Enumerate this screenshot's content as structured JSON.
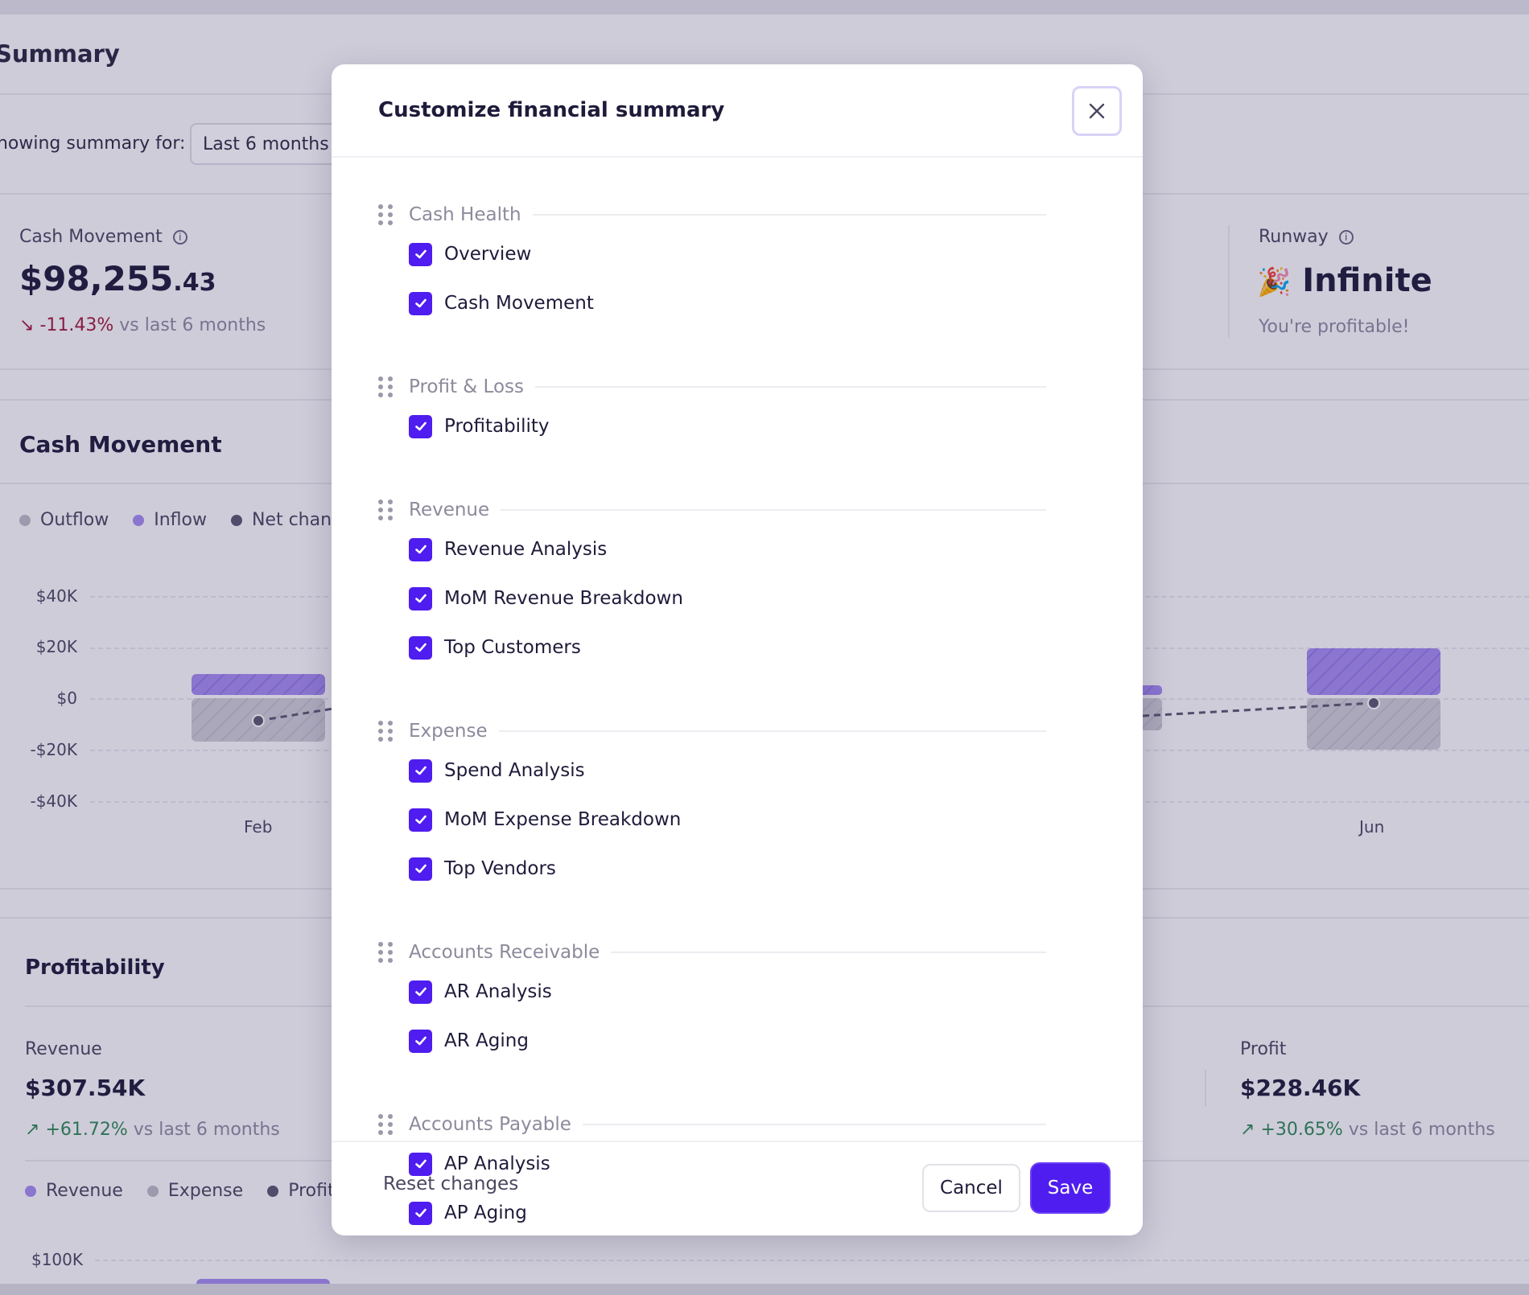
{
  "background": {
    "page_title": "Summary",
    "showing_label": "Showing summary for:",
    "range_value": "Last 6 months",
    "cash_movement": {
      "label": "Cash Movement",
      "value_main": "$98,255",
      "value_cents": ".43",
      "change": "-11.43%",
      "change_suffix": "vs last 6 months"
    },
    "runway": {
      "label": "Runway",
      "value": "Infinite",
      "sub": "You're profitable!"
    },
    "cash_section": {
      "title": "Cash Movement",
      "legend": [
        "Outflow",
        "Inflow",
        "Net change"
      ],
      "y_ticks": [
        "$40K",
        "$20K",
        "$0",
        "-$20K",
        "-$40K"
      ],
      "x_ticks": [
        "Feb",
        "Jun"
      ]
    },
    "profit_section": {
      "title": "Profitability",
      "revenue_label": "Revenue",
      "revenue_value": "$307.54K",
      "revenue_change": "+61.72%",
      "profit_label": "Profit",
      "profit_value": "$228.46K",
      "profit_change": "+30.65%",
      "change_suffix": "vs last 6 months",
      "legend": [
        "Revenue",
        "Expense",
        "Profit"
      ],
      "y_tick_top": "$100K"
    },
    "colors": {
      "inflow": "#8b6fe0",
      "outflow": "#b4b2be",
      "net": "#5b5870",
      "negative": "#a21c3d",
      "positive": "#2f8a55"
    }
  },
  "modal": {
    "title": "Customize financial summary",
    "close_icon": "close-icon",
    "groups": [
      {
        "label": "Cash Health",
        "items": [
          "Overview",
          "Cash Movement"
        ]
      },
      {
        "label": "Profit & Loss",
        "items": [
          "Profitability"
        ]
      },
      {
        "label": "Revenue",
        "items": [
          "Revenue Analysis",
          "MoM Revenue Breakdown",
          "Top Customers"
        ]
      },
      {
        "label": "Expense",
        "items": [
          "Spend Analysis",
          "MoM Expense Breakdown",
          "Top Vendors"
        ]
      },
      {
        "label": "Accounts Receivable",
        "items": [
          "AR Analysis",
          "AR Aging"
        ]
      },
      {
        "label": "Accounts Payable",
        "items": [
          "AP Analysis",
          "AP Aging"
        ]
      }
    ],
    "footer": {
      "reset_label": "Reset changes",
      "cancel_label": "Cancel",
      "save_label": "Save"
    },
    "accent_color": "#4f1df0"
  }
}
